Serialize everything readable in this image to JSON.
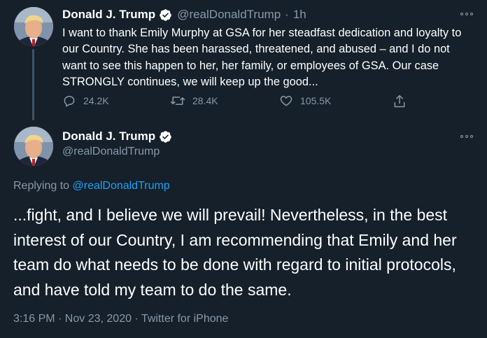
{
  "tweet1": {
    "author_name": "Donald J. Trump",
    "handle": "@realDonaldTrump",
    "separator": "·",
    "time": "1h",
    "text": "I want to thank Emily Murphy at GSA for her steadfast dedication and loyalty to our Country. She has been harassed, threatened, and abused – and I do not want to see this happen to her, her family, or employees of GSA. Our case STRONGLY continues, we will keep up the good...",
    "replies": "24.2K",
    "retweets": "28.4K",
    "likes": "105.5K",
    "avatar_icon": "profile-photo",
    "more_icon": "more-options-icon"
  },
  "tweet2": {
    "author_name": "Donald J. Trump",
    "handle": "@realDonaldTrump",
    "replying_prefix": "Replying to ",
    "replying_to": "@realDonaldTrump",
    "text": "...fight, and I believe we will prevail! Nevertheless, in the best interest of our Country, I am recommending that Emily and her team do what needs to be done with regard to initial protocols, and have told my team to do the same.",
    "timestamp": "3:16 PM · Nov 23, 2020 · ",
    "source": "Twitter for iPhone"
  },
  "colors": {
    "background": "#15202b",
    "text": "#ffffff",
    "secondary": "#8899a6",
    "link": "#1da1f2",
    "verified": "#ffffff"
  }
}
